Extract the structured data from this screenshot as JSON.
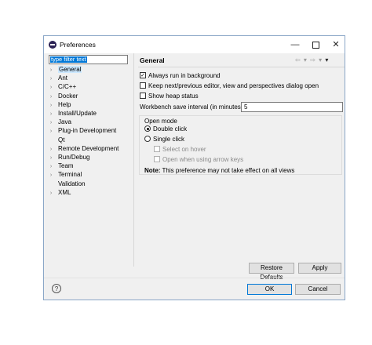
{
  "window": {
    "title": "Preferences",
    "controls": {
      "minimize": "—",
      "close": "✕"
    }
  },
  "filter": {
    "value": "type filter text"
  },
  "tree": {
    "items": [
      {
        "label": "General",
        "expandable": true,
        "selected": true
      },
      {
        "label": "Ant",
        "expandable": true
      },
      {
        "label": "C/C++",
        "expandable": true
      },
      {
        "label": "Docker",
        "expandable": true
      },
      {
        "label": "Help",
        "expandable": true
      },
      {
        "label": "Install/Update",
        "expandable": true
      },
      {
        "label": "Java",
        "expandable": true
      },
      {
        "label": "Plug-in Development",
        "expandable": true
      },
      {
        "label": "Qt",
        "expandable": false
      },
      {
        "label": "Remote Development",
        "expandable": true
      },
      {
        "label": "Run/Debug",
        "expandable": true
      },
      {
        "label": "Team",
        "expandable": true
      },
      {
        "label": "Terminal",
        "expandable": true
      },
      {
        "label": "Validation",
        "expandable": false
      },
      {
        "label": "XML",
        "expandable": true
      }
    ]
  },
  "page": {
    "title": "General",
    "nav": {
      "back": "⇦ ▾",
      "forward": "⇨ ▾",
      "menu": "▾"
    },
    "options": {
      "always_run_bg": {
        "label": "Always run in background",
        "checked": true
      },
      "keep_next_prev": {
        "label": "Keep next/previous editor, view and perspectives dialog open",
        "checked": false
      },
      "show_heap": {
        "label": "Show heap status",
        "checked": false
      }
    },
    "workbench_save": {
      "label": "Workbench save interval (in minutes):",
      "value": "5"
    },
    "open_mode": {
      "title": "Open mode",
      "double_click": "Double click",
      "single_click": "Single click",
      "select_on_hover": "Select on hover",
      "open_arrow_keys": "Open when using arrow keys",
      "selected": "double_click",
      "note_label": "Note:",
      "note_text": " This preference may not take effect on all views"
    }
  },
  "buttons": {
    "restore_defaults": "Restore Defaults",
    "apply": "Apply",
    "ok": "OK",
    "cancel": "Cancel",
    "help": "?"
  }
}
